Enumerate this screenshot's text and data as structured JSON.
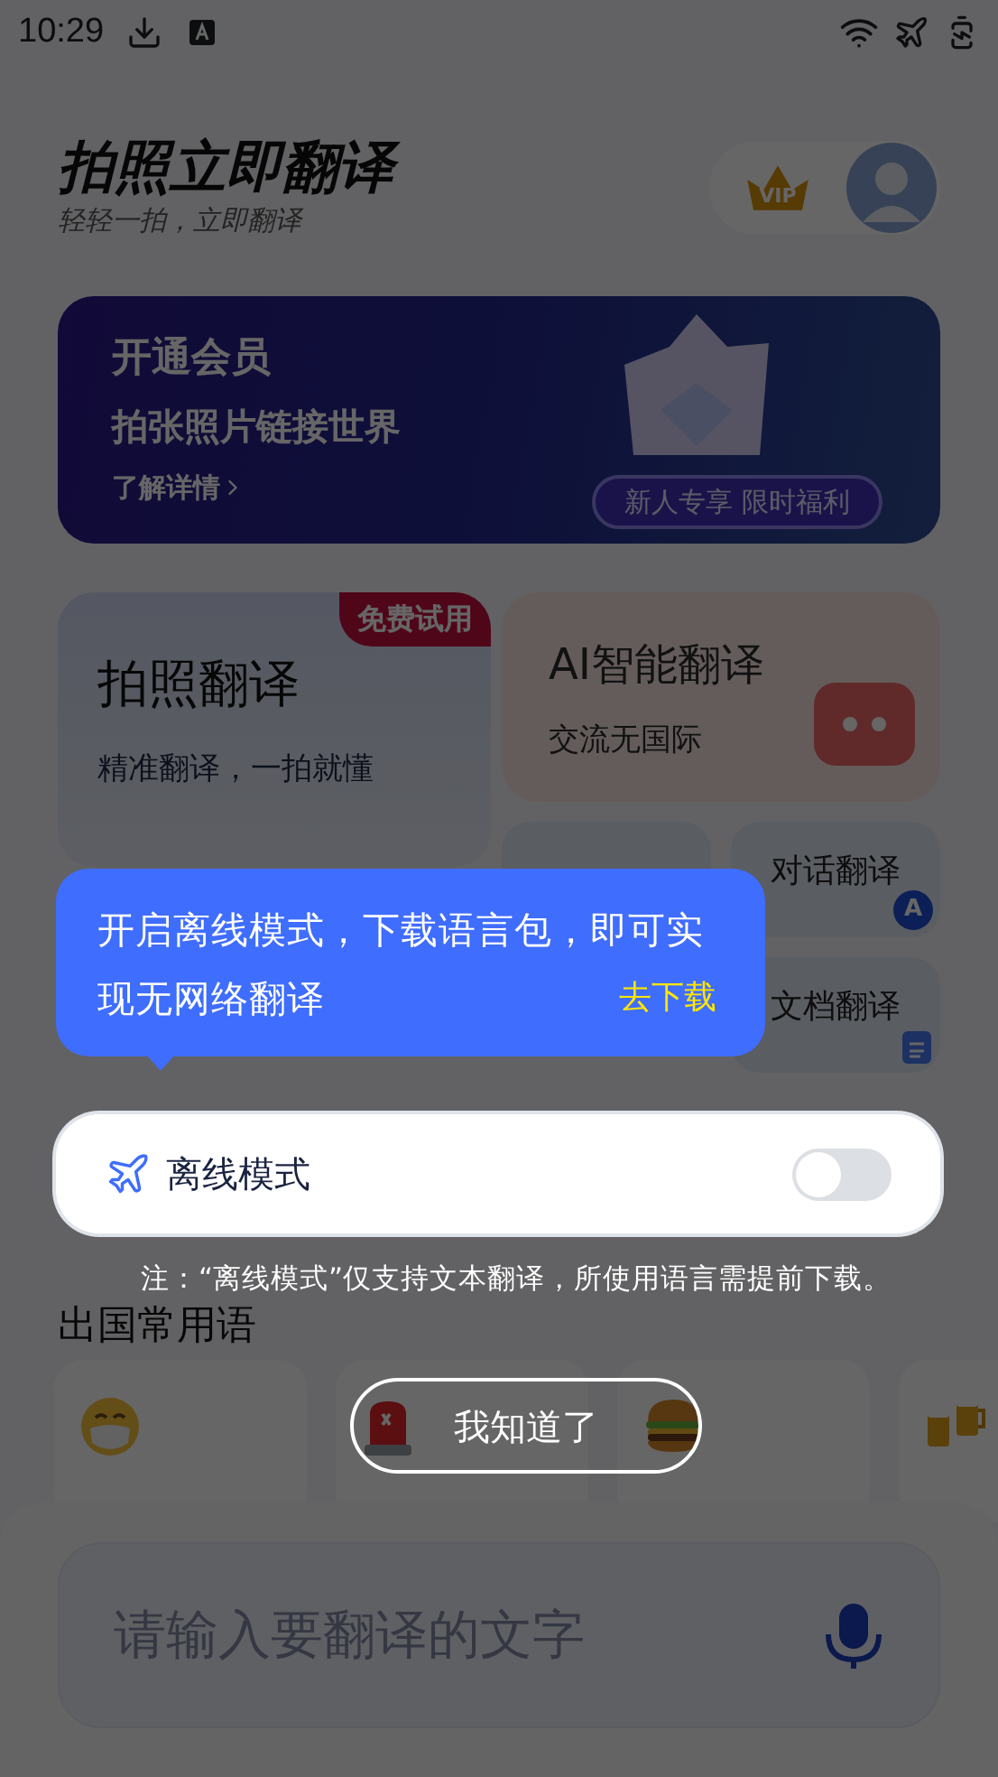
{
  "status_bar": {
    "time": "10:29"
  },
  "header": {
    "title": "拍照立即翻译",
    "subtitle": "轻轻一拍，立即翻译",
    "vip_badge": "VIP"
  },
  "banner": {
    "title": "开通会员",
    "subtitle": "拍张照片链接世界",
    "link": "了解详情",
    "promo": "新人专享 限时福利"
  },
  "photo_card": {
    "title": "拍照翻译",
    "subtitle": "精准翻译，一拍就懂",
    "badge": "免费试用"
  },
  "ai_card": {
    "title": "AI智能翻译",
    "subtitle": "交流无国际"
  },
  "tools": [
    {
      "kind": "none"
    },
    {
      "label": "对话翻译",
      "kind": "letter",
      "icon_text": "A"
    },
    {
      "label": "文档翻译",
      "kind": "doc"
    }
  ],
  "phrases": {
    "title": "出国常用语",
    "items": [
      {
        "kind": "mask"
      },
      {
        "kind": "siren"
      },
      {
        "kind": "burger"
      },
      {
        "kind": "beer"
      }
    ]
  },
  "input": {
    "placeholder": "请输入要翻译的文字"
  },
  "guide": {
    "tooltip": {
      "text": "开启离线模式，下载语言包，即可实现无网络翻译",
      "link": "去下载"
    },
    "offline_mode": {
      "label": "离线模式",
      "on": false
    },
    "note": "注：“离线模式”仅支持文本翻译，所使用语言需提前下载。",
    "dismiss": "我知道了"
  }
}
